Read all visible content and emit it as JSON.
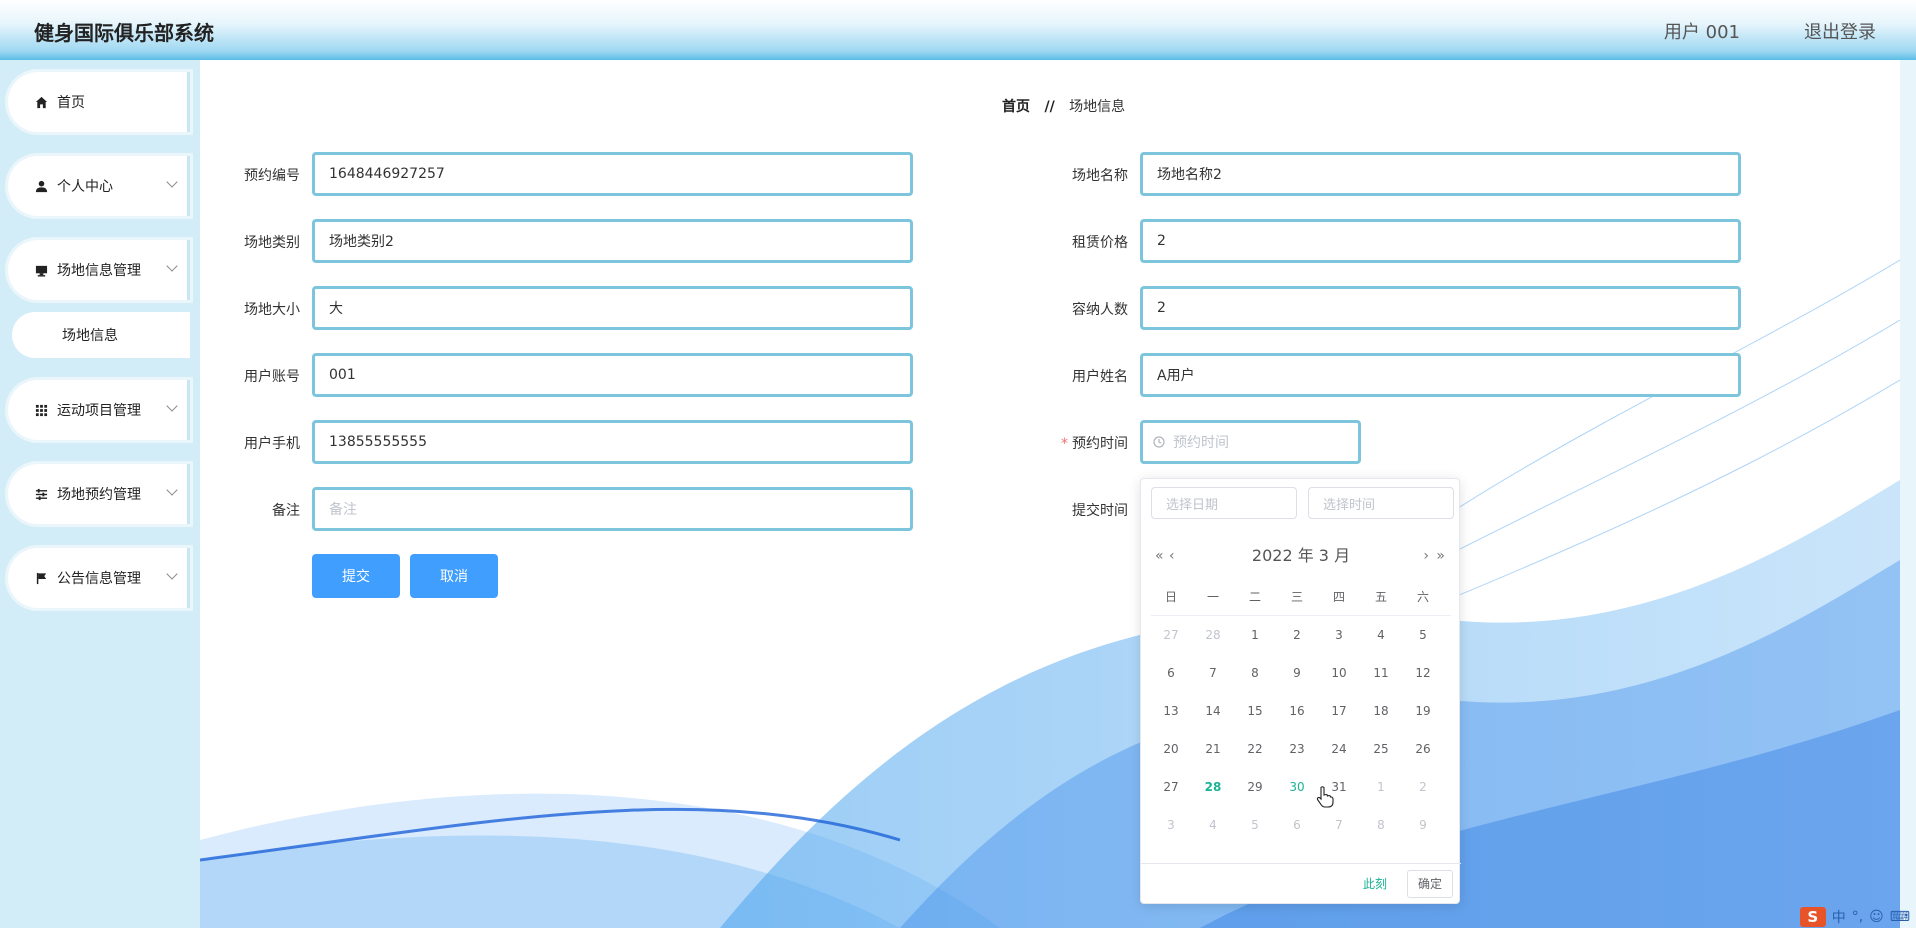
{
  "header": {
    "title": "健身国际俱乐部系统",
    "user": "用户 001",
    "logout": "退出登录"
  },
  "sidebar": {
    "items": [
      {
        "label": "首页",
        "icon": "home-icon"
      },
      {
        "label": "个人中心",
        "icon": "person-icon"
      },
      {
        "label": "场地信息管理",
        "icon": "monitor-icon"
      },
      {
        "label": "运动项目管理",
        "icon": "grid-icon"
      },
      {
        "label": "场地预约管理",
        "icon": "sliders-icon"
      },
      {
        "label": "公告信息管理",
        "icon": "flag-icon"
      }
    ],
    "submenu": {
      "label": "场地信息"
    }
  },
  "breadcrumb": {
    "home": "首页",
    "sep": "//",
    "current": "场地信息"
  },
  "form": {
    "left": [
      {
        "label": "预约编号",
        "value": "1648446927257"
      },
      {
        "label": "场地类别",
        "value": "场地类别2"
      },
      {
        "label": "场地大小",
        "value": "大"
      },
      {
        "label": "用户账号",
        "value": "001"
      },
      {
        "label": "用户手机",
        "value": "13855555555"
      },
      {
        "label": "备注",
        "placeholder": "备注"
      }
    ],
    "right": [
      {
        "label": "场地名称",
        "value": "场地名称2"
      },
      {
        "label": "租赁价格",
        "value": "2"
      },
      {
        "label": "容纳人数",
        "value": "2"
      },
      {
        "label": "用户姓名",
        "value": "A用户"
      },
      {
        "label": "预约时间",
        "placeholder": "预约时间",
        "required": "*"
      },
      {
        "label": "提交时间"
      }
    ],
    "submit": "提交",
    "cancel": "取消"
  },
  "datepicker": {
    "date_placeholder": "选择日期",
    "time_placeholder": "选择时间",
    "header": "2022 年  3 月",
    "weekdays": [
      "日",
      "一",
      "二",
      "三",
      "四",
      "五",
      "六"
    ],
    "weeks": [
      [
        "27",
        "28",
        "1",
        "2",
        "3",
        "4",
        "5"
      ],
      [
        "6",
        "7",
        "8",
        "9",
        "10",
        "11",
        "12"
      ],
      [
        "13",
        "14",
        "15",
        "16",
        "17",
        "18",
        "19"
      ],
      [
        "20",
        "21",
        "22",
        "23",
        "24",
        "25",
        "26"
      ],
      [
        "27",
        "28",
        "29",
        "30",
        "31",
        "1",
        "2"
      ],
      [
        "3",
        "4",
        "5",
        "6",
        "7",
        "8",
        "9"
      ]
    ],
    "today": "28",
    "hovered": "30",
    "now_label": "此刻",
    "ok_label": "确定"
  },
  "ime": {
    "logo": "S",
    "mode": "中",
    "punct": "°,"
  },
  "colors": {
    "accent": "#409eff",
    "field_border": "#7cc5dc",
    "today": "#1ab394",
    "required": "#f56c6c"
  }
}
